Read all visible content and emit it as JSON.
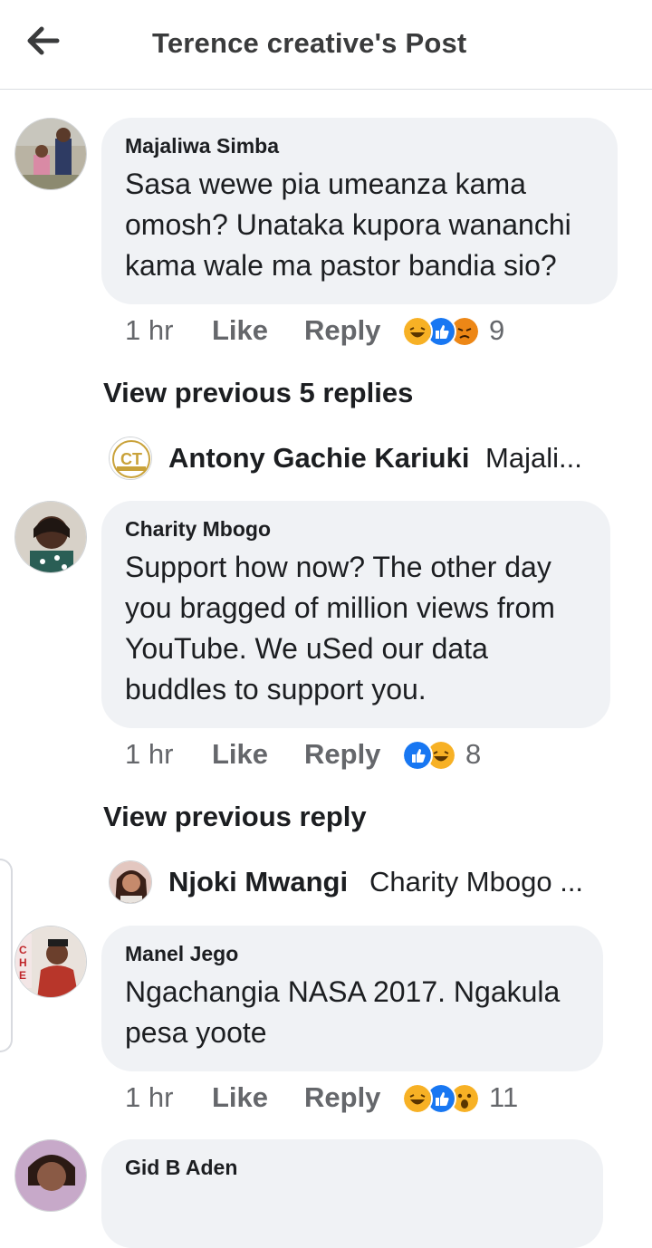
{
  "header": {
    "title": "Terence creative's Post"
  },
  "comments": [
    {
      "author": "Majaliwa Simba",
      "text": "Sasa wewe pia umeanza kama omosh? Unataka kupora wananchi kama wale ma pastor bandia sio?",
      "time": "1 hr",
      "like": "Like",
      "reply": "Reply",
      "reaction_count": "9",
      "reactions": [
        "haha",
        "like",
        "angry"
      ]
    },
    {
      "author": "Charity Mbogo",
      "text": "Support how now? The other day you bragged of million views from YouTube. We uSed our data buddles to support you.",
      "time": "1 hr",
      "like": "Like",
      "reply": "Reply",
      "reaction_count": "8",
      "reactions": [
        "like",
        "haha"
      ]
    },
    {
      "author": "Manel Jego",
      "text": "Ngachangia NASA 2017. Ngakula pesa yoote",
      "time": "1 hr",
      "like": "Like",
      "reply": "Reply",
      "reaction_count": "11",
      "reactions": [
        "haha",
        "like",
        "wow"
      ]
    },
    {
      "author": "Gid B Aden"
    }
  ],
  "threads": [
    {
      "view_previous": "View previous 5 replies",
      "reply_name": "Antony Gachie Kariuki",
      "reply_snippet": "Majali..."
    },
    {
      "view_previous": "View previous reply",
      "reply_name": "Njoki Mwangi",
      "reply_snippet": "Charity Mbogo ..."
    }
  ],
  "icons": {
    "back": "arrow-left-icon",
    "reaction_colors": {
      "like": "#1877f2",
      "haha": "#f7b125",
      "angry": "#e9710f",
      "wow": "#f7b125"
    }
  }
}
